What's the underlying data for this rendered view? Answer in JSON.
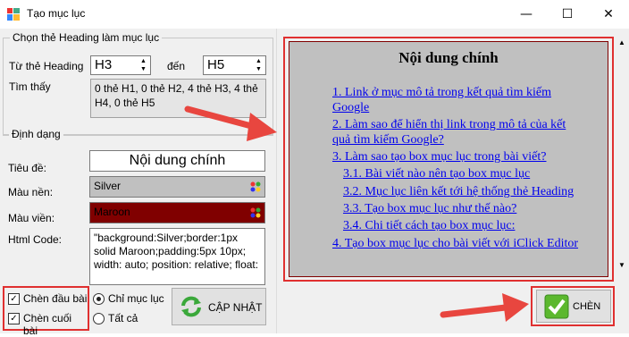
{
  "window": {
    "title": "Tạo mục lục",
    "min": "—",
    "max": "☐",
    "close": "✕"
  },
  "heading_group": {
    "legend": "Chọn thẻ Heading làm mục lục",
    "from_label": "Từ thẻ Heading",
    "from_value": "H3",
    "to_label": "đến",
    "to_value": "H5",
    "found_label": "Tìm thấy",
    "found_text": "0 thẻ H1, 0 thẻ H2, 4 thẻ H3, 4 thẻ H4, 0 thẻ H5"
  },
  "format_group": {
    "legend": "Định dạng",
    "title_label": "Tiêu đề:",
    "title_value": "Nội dung chính",
    "bg_label": "Màu nền:",
    "bg_value": "Silver",
    "border_label": "Màu viền:",
    "border_value": "Maroon",
    "html_label": "Html Code:",
    "html_value": "\"background:Silver;border:1px solid Maroon;padding:5px 10px; width: auto; position: relative; float:"
  },
  "options": {
    "insert_top": "Chèn đầu bài",
    "insert_bottom": "Chèn cuối bài",
    "only_toc": "Chỉ mục lục",
    "all": "Tất cả",
    "update_button": "CẬP NHẬT"
  },
  "preview": {
    "heading": "Nội dung chính",
    "items": [
      "1. Link ở  mục mô tả trong kết quả tìm kiếm",
      "Google",
      "2. Làm sao để hiển thị link trong mô tả của kết",
      "quả tìm kiếm Google?",
      "3. Làm sao tạo box mục lục trong bài viết?",
      "3.1. Bài viết nào nên tạo box mục lục",
      "3.2. Mục lục liên kết tới hệ thống thẻ Heading",
      "3.3. Tạo box mục lục như thế nào?",
      "3.4. Chi tiết cách tạo box mục lục:",
      "4. Tạo box mục lục cho bài viết với iClick Editor"
    ]
  },
  "insert_button": "CHÈN",
  "colors": {
    "silver": "#c0c0c0",
    "maroon": "#800000",
    "highlight": "#e03030",
    "arrow": "#e8463f",
    "link": "#0000ee"
  }
}
